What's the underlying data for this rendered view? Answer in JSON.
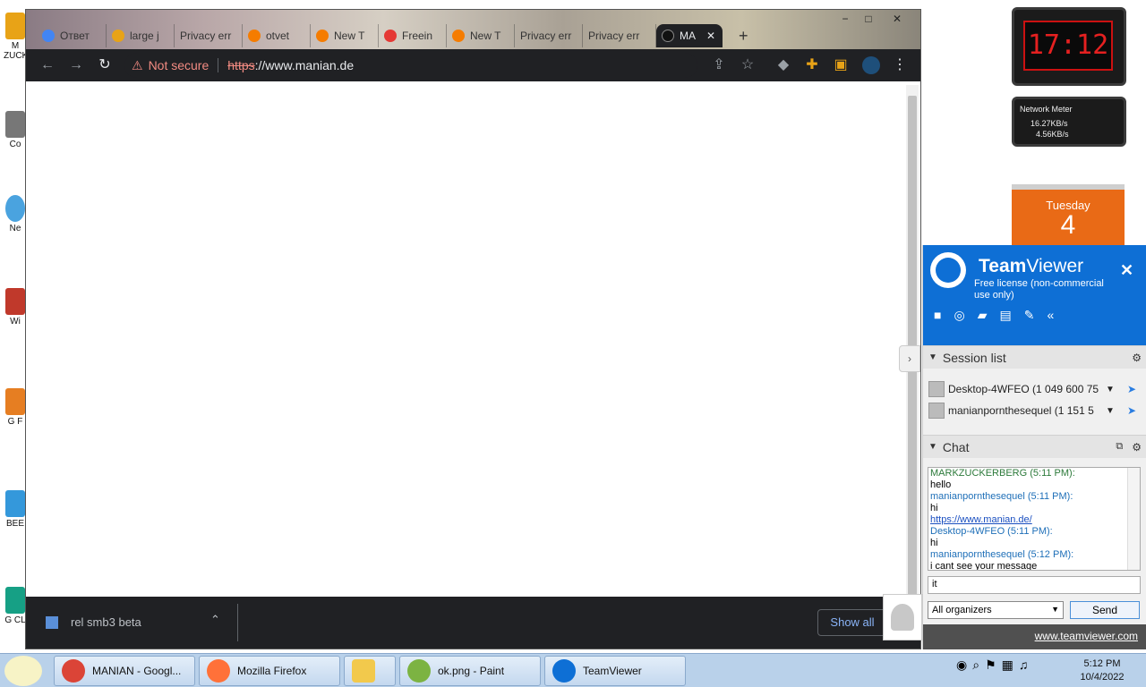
{
  "browser": {
    "tabs": [
      {
        "label": "Ответ",
        "color": "#4285f4"
      },
      {
        "label": "large j",
        "color": "#e8a317"
      },
      {
        "label": "Privacy err",
        "color": "#9e9e9e"
      },
      {
        "label": "otvet",
        "color": "#f57c00"
      },
      {
        "label": "New T",
        "color": "#f57c00"
      },
      {
        "label": "Freein",
        "color": "#e53935"
      },
      {
        "label": "New T",
        "color": "#f57c00"
      },
      {
        "label": "Privacy err",
        "color": "#9e9e9e"
      },
      {
        "label": "Privacy err",
        "color": "#9e9e9e"
      },
      {
        "label": "MA",
        "color": "#111111"
      }
    ],
    "new_tab": "+",
    "security": "Not secure",
    "url_scheme": "https",
    "url_rest": "://www.manian.de",
    "download_item": "rel smb3 beta",
    "show_all": "Show all",
    "win_minimize": "−",
    "win_restore": "□",
    "win_close": "✕"
  },
  "teamviewer": {
    "title_bold": "Team",
    "title_light": "Viewer",
    "subtitle": "Free license (non-commercial use only)",
    "close": "✕",
    "session_list_label": "Session list",
    "sessions": [
      {
        "name": "Desktop-4WFEO (1 049 600 75"
      },
      {
        "name": "manianpornthesequel (1 151 5"
      }
    ],
    "chat_label": "Chat",
    "chat_messages": [
      {
        "sender": "MARKZUCKERBERG (5:11 PM):",
        "text": "hello"
      },
      {
        "sender": "manianpornthesequel (5:11 PM):",
        "text": "hi"
      },
      {
        "sender": "",
        "text": "https://www.manian.de/"
      },
      {
        "sender": "Desktop-4WFEO (5:11 PM):",
        "text": "hi"
      },
      {
        "sender": "manianpornthesequel (5:12 PM):",
        "text": "i cant see your message"
      }
    ],
    "chat_input": "it",
    "recipient": "All organizers",
    "send": "Send",
    "footer_link": "www.teamviewer.com"
  },
  "gadgets": {
    "clock_time": "17:12",
    "network_title": "Network Meter",
    "net_down": "16.27KB/s",
    "net_up": "4.56KB/s",
    "calendar_day": "Tuesday",
    "calendar_date": "4"
  },
  "taskbar": {
    "items": [
      {
        "label": "MANIAN - Googl...",
        "color": "#db4437"
      },
      {
        "label": "Mozilla Firefox",
        "color": "#ff7139"
      },
      {
        "label": "",
        "color": "#f2c94c"
      },
      {
        "label": "ok.png - Paint",
        "color": "#7cb342"
      },
      {
        "label": "TeamViewer",
        "color": "#0e6fd5"
      }
    ],
    "time": "5:12 PM",
    "date": "10/4/2022"
  },
  "desktop_icons": [
    {
      "label": "M ZUCK"
    },
    {
      "label": "Co"
    },
    {
      "label": "Ne"
    },
    {
      "label": "Wi"
    },
    {
      "label": "G F"
    },
    {
      "label": "BEE"
    },
    {
      "label": "G CL"
    }
  ]
}
